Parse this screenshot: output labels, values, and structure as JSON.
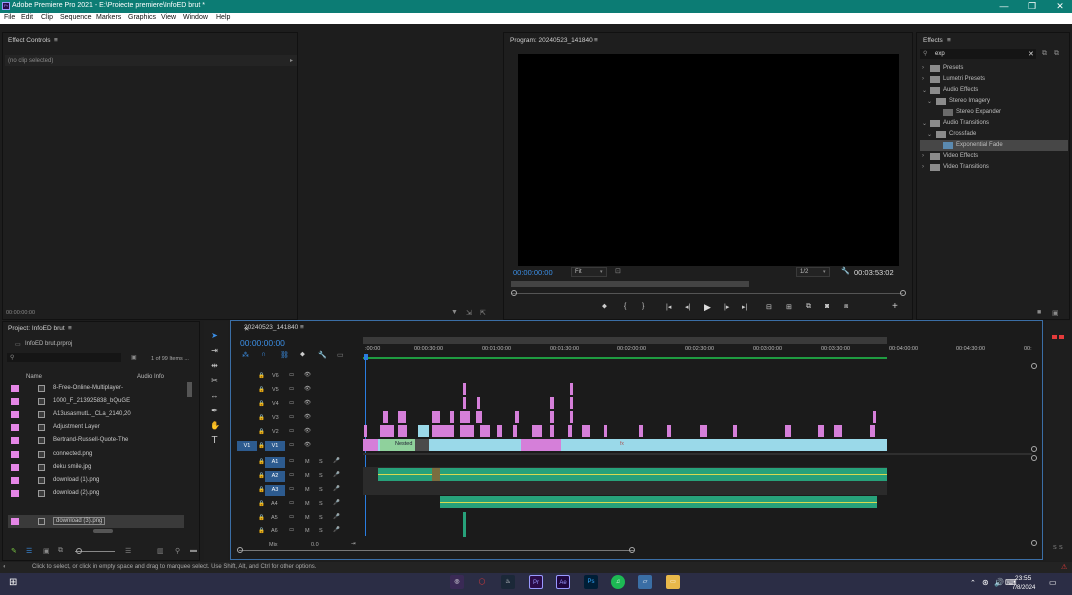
{
  "window": {
    "title": "Adobe Premiere Pro 2021 - E:\\Proiecte premiere\\InfoED brut *",
    "app_icon": "Pr",
    "controls": [
      "—",
      "❐",
      "✕"
    ]
  },
  "menu": [
    "File",
    "Edit",
    "Clip",
    "Sequence",
    "Markers",
    "Graphics",
    "View",
    "Window",
    "Help"
  ],
  "effect_controls": {
    "title": "Effect Controls",
    "menu": "≡",
    "no_clip": "(no clip selected)",
    "timecode": "00:00:00:00"
  },
  "program": {
    "title": "Program: 20240523_141840",
    "menu": "≡",
    "timecode": "00:00:00:00",
    "fit": "Fit",
    "resolution": "1/2",
    "duration": "00:03:53:02"
  },
  "effects": {
    "title": "Effects",
    "menu": "≡",
    "search_value": "exp",
    "tree": [
      {
        "label": "Presets",
        "level": 0,
        "type": "folder"
      },
      {
        "label": "Lumetri Presets",
        "level": 0,
        "type": "folder"
      },
      {
        "label": "Audio Effects",
        "level": 0,
        "type": "folder"
      },
      {
        "label": "Stereo Imagery",
        "level": 1,
        "type": "folder"
      },
      {
        "label": "Stereo Expander",
        "level": 2,
        "type": "effect"
      },
      {
        "label": "Audio Transitions",
        "level": 0,
        "type": "folder"
      },
      {
        "label": "Crossfade",
        "level": 1,
        "type": "folder"
      },
      {
        "label": "Exponential Fade",
        "level": 2,
        "type": "effect",
        "selected": true
      },
      {
        "label": "Video Effects",
        "level": 0,
        "type": "folder"
      },
      {
        "label": "Video Transitions",
        "level": 0,
        "type": "folder"
      }
    ]
  },
  "project": {
    "title": "Project: InfoED brut",
    "menu": "≡",
    "file": "InfoED brut.prproj",
    "count": "1 of 99 Items ...",
    "col_name": "Name",
    "col_audio": "Audio Info",
    "items": [
      "8-Free-Online-Multiplayer-",
      "1000_F_213925838_bQuGE",
      "A13usasmutL._CLa_2140,20",
      "Adjustment Layer",
      "Bertrand-Russell-Quote-The",
      "connected.png",
      "deku smile.jpg",
      "download (1).png",
      "download (2).png",
      "download (3).png"
    ]
  },
  "timeline": {
    "title": "20240523_141840",
    "menu": "≡",
    "timecode": "00:00:00:00",
    "ruler": [
      ":00:00",
      "00:00:30:00",
      "00:01:00:00",
      "00:01:30:00",
      "00:02:00:00",
      "00:02:30:00",
      "00:03:00:00",
      "00:03:30:00",
      "00:04:00:00",
      "00:04:30:00",
      "00:"
    ],
    "video_tracks": [
      "V6",
      "V5",
      "V4",
      "V3",
      "V2",
      "V1"
    ],
    "source_v": "V1",
    "audio_tracks": [
      "A1",
      "A2",
      "A3",
      "A4",
      "A5",
      "A6"
    ],
    "mute": "M",
    "solo": "S",
    "mix_label": "Mix",
    "mix_value": "0.0",
    "nested_label": "Nested",
    "fx_badge": "fx"
  },
  "meter": {
    "labels": [
      "S",
      "S"
    ]
  },
  "status": {
    "text": "Click to select, or click in empty space and drag to marquee select. Use Shift, Alt, and Ctrl for other options."
  },
  "taskbar": {
    "time": "23:55",
    "date": "7/8/2024",
    "apps": [
      "Pr",
      "Ae",
      "Ps"
    ]
  }
}
